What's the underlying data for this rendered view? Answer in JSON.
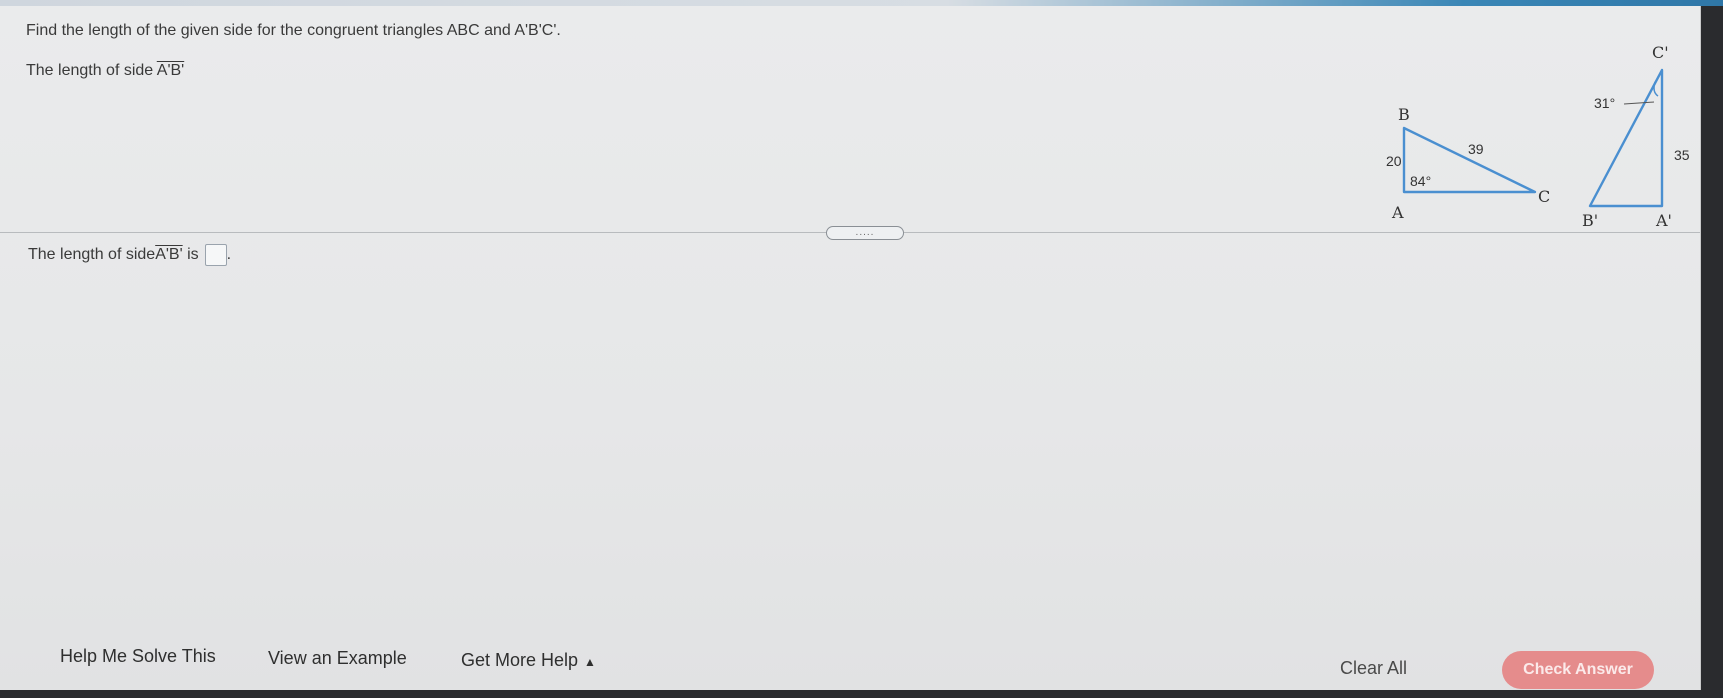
{
  "question": {
    "instruction": "Find the length of the given side for the congruent triangles ABC and A'B'C'.",
    "prompt_prefix": "The length of side ",
    "prompt_side": "A'B'",
    "answer_prefix": "The length of side ",
    "answer_side": "A'B'",
    "answer_suffix": " is",
    "answer_value": "",
    "answer_end": "."
  },
  "figure": {
    "triangle1": {
      "vertex_a": "A",
      "vertex_b": "B",
      "vertex_c": "C",
      "side_ab": "20",
      "side_bc": "39",
      "angle_a": "84°"
    },
    "triangle2": {
      "vertex_a": "A'",
      "vertex_b": "B'",
      "vertex_c": "C'",
      "side_ac": "35",
      "angle_c": "31°"
    }
  },
  "divider": {
    "handle": "....."
  },
  "footer": {
    "help_me_solve": "Help Me Solve This",
    "view_example": "View an Example",
    "get_more_help": "Get More Help",
    "get_more_help_caret": "▲",
    "clear_all": "Clear All",
    "check_answer": "Check Answer"
  },
  "colors": {
    "triangle_stroke": "#4a8fd0",
    "check_answer_bg": "#e58c8c",
    "accent": "#2f77a8"
  }
}
